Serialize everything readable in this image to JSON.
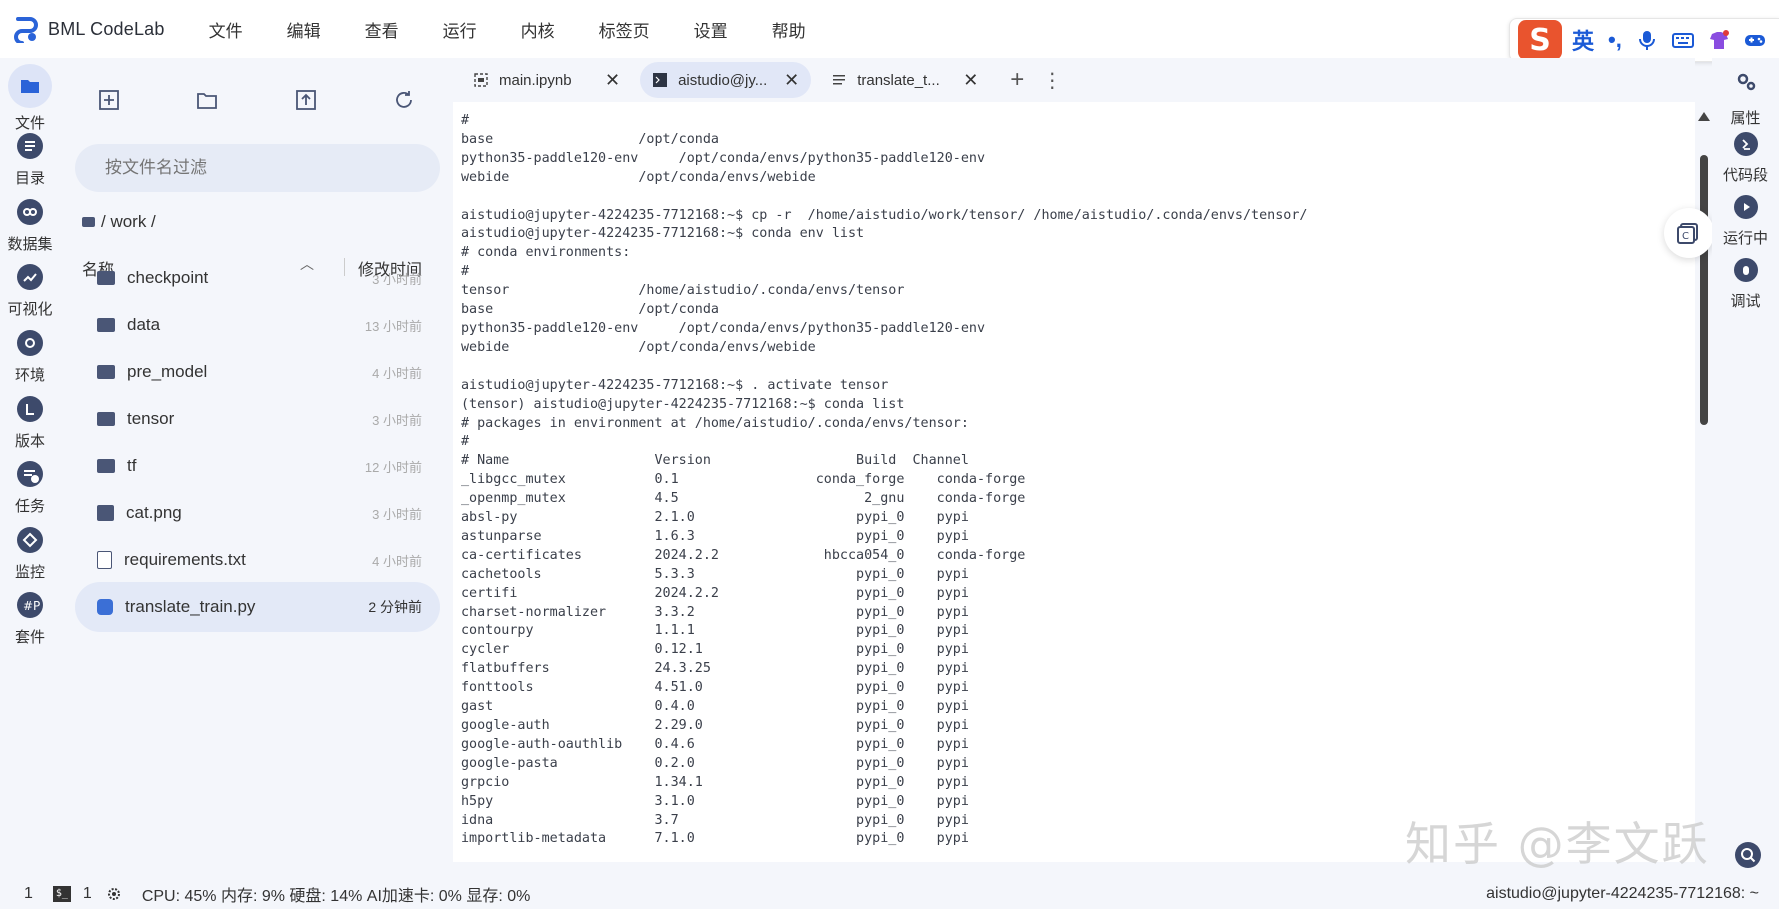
{
  "app": {
    "title": "BML CodeLab"
  },
  "menu": [
    "文件",
    "编辑",
    "查看",
    "运行",
    "内核",
    "标签页",
    "设置",
    "帮助"
  ],
  "ime": {
    "label": "英",
    "punct": "•,"
  },
  "left_rail": [
    {
      "label": "文件",
      "icon": "folder-icon"
    },
    {
      "label": "目录",
      "icon": "list-icon"
    },
    {
      "label": "数据集",
      "icon": "dataset-icon"
    },
    {
      "label": "可视化",
      "icon": "chart-icon"
    },
    {
      "label": "环境",
      "icon": "env-icon"
    },
    {
      "label": "版本",
      "icon": "version-icon"
    },
    {
      "label": "任务",
      "icon": "task-icon"
    },
    {
      "label": "监控",
      "icon": "monitor-icon"
    },
    {
      "label": "套件",
      "icon": "suite-icon"
    }
  ],
  "file_browser": {
    "search_placeholder": "按文件名过滤",
    "breadcrumb": "/ work /",
    "col_name": "名称",
    "col_modified": "修改时间",
    "files": [
      {
        "name": "checkpoint",
        "time": "3 小时前",
        "type": "folder"
      },
      {
        "name": "data",
        "time": "13 小时前",
        "type": "folder"
      },
      {
        "name": "pre_model",
        "time": "4 小时前",
        "type": "folder"
      },
      {
        "name": "tensor",
        "time": "3 小时前",
        "type": "folder"
      },
      {
        "name": "tf",
        "time": "12 小时前",
        "type": "folder"
      },
      {
        "name": "cat.png",
        "time": "3 小时前",
        "type": "image"
      },
      {
        "name": "requirements.txt",
        "time": "4 小时前",
        "type": "text"
      },
      {
        "name": "translate_train.py",
        "time": "2 分钟前",
        "type": "python",
        "selected": true
      }
    ]
  },
  "tabs": [
    {
      "label": "main.ipynb",
      "icon": "notebook-icon",
      "active": false
    },
    {
      "label": "aistudio@jy...",
      "icon": "terminal-icon",
      "active": true
    },
    {
      "label": "translate_t...",
      "icon": "text-file-icon",
      "active": false
    }
  ],
  "terminal_lines": [
    "#",
    "base                  /opt/conda",
    "python35-paddle120-env     /opt/conda/envs/python35-paddle120-env",
    "webide                /opt/conda/envs/webide",
    "",
    "aistudio@jupyter-4224235-7712168:~$ cp -r  /home/aistudio/work/tensor/ /home/aistudio/.conda/envs/tensor/",
    "aistudio@jupyter-4224235-7712168:~$ conda env list",
    "# conda environments:",
    "#",
    "tensor                /home/aistudio/.conda/envs/tensor",
    "base                  /opt/conda",
    "python35-paddle120-env     /opt/conda/envs/python35-paddle120-env",
    "webide                /opt/conda/envs/webide",
    "",
    "aistudio@jupyter-4224235-7712168:~$ . activate tensor",
    "(tensor) aistudio@jupyter-4224235-7712168:~$ conda list",
    "# packages in environment at /home/aistudio/.conda/envs/tensor:",
    "#",
    "# Name                  Version                  Build  Channel",
    "_libgcc_mutex           0.1                 conda_forge    conda-forge",
    "_openmp_mutex           4.5                       2_gnu    conda-forge",
    "absl-py                 2.1.0                    pypi_0    pypi",
    "astunparse              1.6.3                    pypi_0    pypi",
    "ca-certificates         2024.2.2             hbcca054_0    conda-forge",
    "cachetools              5.3.3                    pypi_0    pypi",
    "certifi                 2024.2.2                 pypi_0    pypi",
    "charset-normalizer      3.3.2                    pypi_0    pypi",
    "contourpy               1.1.1                    pypi_0    pypi",
    "cycler                  0.12.1                   pypi_0    pypi",
    "flatbuffers             24.3.25                  pypi_0    pypi",
    "fonttools               4.51.0                   pypi_0    pypi",
    "gast                    0.4.0                    pypi_0    pypi",
    "google-auth             2.29.0                   pypi_0    pypi",
    "google-auth-oauthlib    0.4.6                    pypi_0    pypi",
    "google-pasta            0.2.0                    pypi_0    pypi",
    "grpcio                  1.34.1                   pypi_0    pypi",
    "h5py                    3.1.0                    pypi_0    pypi",
    "idna                    3.7                      pypi_0    pypi",
    "importlib-metadata      7.1.0                    pypi_0    pypi"
  ],
  "right_rail": [
    {
      "label": "属性",
      "icon": "gears-icon"
    },
    {
      "label": "代码段",
      "icon": "snippet-icon"
    },
    {
      "label": "运行中",
      "icon": "running-icon"
    },
    {
      "label": "调试",
      "icon": "debug-icon"
    }
  ],
  "watermark": "知乎 @李文跃",
  "status": {
    "count1": "1",
    "count2": "1",
    "resources": "CPU:  45% 内存:  9% 硬盘:  14% AI加速卡:  0% 显存:  0%",
    "right": "aistudio@jupyter-4224235-7712168: ~"
  }
}
